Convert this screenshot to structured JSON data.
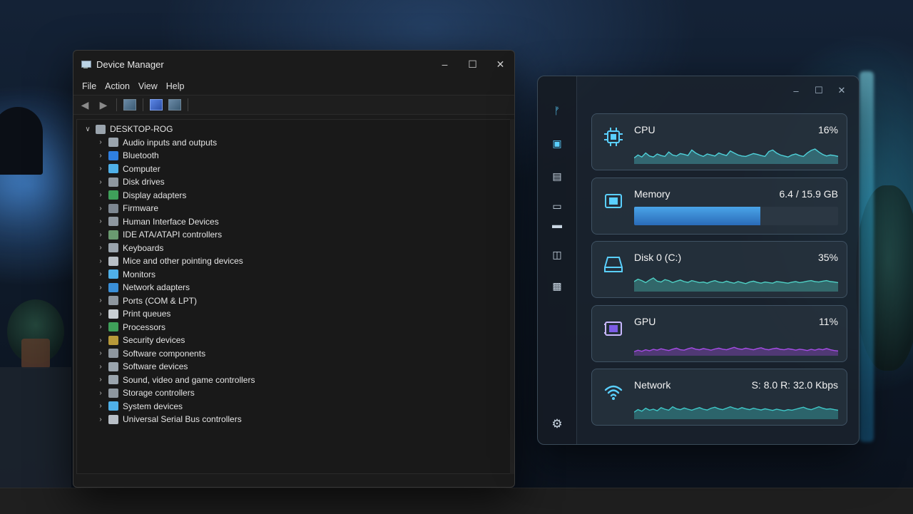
{
  "device_manager": {
    "title": "Device Manager",
    "menu": [
      "File",
      "Action",
      "View",
      "Help"
    ],
    "root": "DESKTOP-ROG",
    "categories": [
      {
        "label": "Audio inputs and outputs",
        "icon": "speaker-icon",
        "color": "#9aa4ad"
      },
      {
        "label": "Bluetooth",
        "icon": "bluetooth-icon",
        "color": "#2f7fe0"
      },
      {
        "label": "Computer",
        "icon": "computer-icon",
        "color": "#4fb0e8"
      },
      {
        "label": "Disk drives",
        "icon": "disk-drive-icon",
        "color": "#8e979f"
      },
      {
        "label": "Display adapters",
        "icon": "display-adapter-icon",
        "color": "#3fa05a"
      },
      {
        "label": "Firmware",
        "icon": "firmware-icon",
        "color": "#7d8791"
      },
      {
        "label": "Human Interface Devices",
        "icon": "hid-icon",
        "color": "#8e979f"
      },
      {
        "label": "IDE ATA/ATAPI controllers",
        "icon": "ide-controller-icon",
        "color": "#6a9a70"
      },
      {
        "label": "Keyboards",
        "icon": "keyboard-icon",
        "color": "#9aa4ad"
      },
      {
        "label": "Mice and other pointing devices",
        "icon": "mouse-icon",
        "color": "#b8bfc6"
      },
      {
        "label": "Monitors",
        "icon": "monitor-icon",
        "color": "#4fb0e8"
      },
      {
        "label": "Network adapters",
        "icon": "network-adapter-icon",
        "color": "#3a8fd8"
      },
      {
        "label": "Ports (COM & LPT)",
        "icon": "port-icon",
        "color": "#8e979f"
      },
      {
        "label": "Print queues",
        "icon": "printer-icon",
        "color": "#c9cfd4"
      },
      {
        "label": "Processors",
        "icon": "processor-icon",
        "color": "#3fa05a"
      },
      {
        "label": "Security devices",
        "icon": "security-device-icon",
        "color": "#b89a3a"
      },
      {
        "label": "Software components",
        "icon": "software-component-icon",
        "color": "#8e979f"
      },
      {
        "label": "Software devices",
        "icon": "software-device-icon",
        "color": "#9aa4ad"
      },
      {
        "label": "Sound, video and game controllers",
        "icon": "sound-icon",
        "color": "#9aa4ad"
      },
      {
        "label": "Storage controllers",
        "icon": "storage-controller-icon",
        "color": "#8e979f"
      },
      {
        "label": "System devices",
        "icon": "system-device-icon",
        "color": "#4fb0e8"
      },
      {
        "label": "Universal Serial Bus controllers",
        "icon": "usb-icon",
        "color": "#b8bfc6"
      }
    ]
  },
  "monitor": {
    "nav_icons": [
      "logo-icon",
      "cpu-nav-icon",
      "memory-nav-icon",
      "disk-nav-icon",
      "gpu-nav-icon",
      "network-nav-icon",
      "app-nav-icon",
      "settings-icon"
    ],
    "cards": [
      {
        "name": "CPU",
        "value": "16%",
        "icon": "cpu-icon",
        "type": "graph",
        "color": "#4fd1d9",
        "samples": [
          0.3,
          0.45,
          0.35,
          0.55,
          0.4,
          0.35,
          0.5,
          0.42,
          0.38,
          0.6,
          0.45,
          0.4,
          0.52,
          0.48,
          0.42,
          0.7,
          0.55,
          0.45,
          0.38,
          0.5,
          0.45,
          0.4,
          0.55,
          0.48,
          0.42,
          0.65,
          0.55,
          0.45,
          0.4,
          0.38,
          0.45,
          0.52,
          0.48,
          0.42,
          0.38,
          0.62,
          0.7,
          0.55,
          0.45,
          0.4,
          0.35,
          0.45,
          0.5,
          0.42,
          0.38,
          0.55,
          0.68,
          0.75,
          0.6,
          0.48,
          0.4,
          0.45,
          0.42,
          0.38
        ]
      },
      {
        "name": "Memory",
        "value": "6.4 / 15.9 GB",
        "icon": "memory-icon",
        "type": "bar",
        "color": "#3b8fdc",
        "usage": 0.62
      },
      {
        "name": "Disk 0 (C:)",
        "value": "35%",
        "icon": "disk-icon",
        "type": "graph",
        "color": "#4fd1c5",
        "samples": [
          0.5,
          0.62,
          0.55,
          0.45,
          0.58,
          0.68,
          0.52,
          0.48,
          0.6,
          0.55,
          0.45,
          0.52,
          0.58,
          0.5,
          0.46,
          0.55,
          0.5,
          0.45,
          0.48,
          0.42,
          0.5,
          0.55,
          0.48,
          0.45,
          0.52,
          0.46,
          0.42,
          0.5,
          0.45,
          0.4,
          0.48,
          0.52,
          0.46,
          0.42,
          0.48,
          0.45,
          0.42,
          0.5,
          0.48,
          0.45,
          0.42,
          0.47,
          0.5,
          0.45,
          0.48,
          0.52,
          0.55,
          0.5,
          0.48,
          0.52,
          0.55,
          0.5,
          0.48,
          0.45
        ]
      },
      {
        "name": "GPU",
        "value": "11%",
        "icon": "gpu-icon",
        "type": "graph",
        "color": "#a64ce6",
        "samples": [
          0.2,
          0.28,
          0.22,
          0.3,
          0.25,
          0.32,
          0.28,
          0.35,
          0.3,
          0.26,
          0.33,
          0.38,
          0.3,
          0.28,
          0.35,
          0.4,
          0.33,
          0.3,
          0.36,
          0.32,
          0.28,
          0.34,
          0.38,
          0.33,
          0.3,
          0.36,
          0.42,
          0.35,
          0.32,
          0.38,
          0.34,
          0.3,
          0.36,
          0.4,
          0.33,
          0.3,
          0.35,
          0.38,
          0.32,
          0.3,
          0.35,
          0.32,
          0.28,
          0.33,
          0.3,
          0.26,
          0.32,
          0.28,
          0.34,
          0.3,
          0.36,
          0.3,
          0.26,
          0.24
        ]
      },
      {
        "name": "Network",
        "value": "S: 8.0  R: 32.0 Kbps",
        "icon": "wifi-icon",
        "type": "graph",
        "color": "#3fc8c8",
        "samples": [
          0.35,
          0.48,
          0.4,
          0.55,
          0.45,
          0.5,
          0.42,
          0.58,
          0.5,
          0.45,
          0.62,
          0.52,
          0.48,
          0.56,
          0.5,
          0.45,
          0.52,
          0.58,
          0.5,
          0.46,
          0.55,
          0.6,
          0.52,
          0.48,
          0.55,
          0.62,
          0.55,
          0.5,
          0.58,
          0.52,
          0.48,
          0.55,
          0.5,
          0.46,
          0.52,
          0.48,
          0.44,
          0.5,
          0.46,
          0.42,
          0.48,
          0.45,
          0.5,
          0.55,
          0.6,
          0.52,
          0.48,
          0.55,
          0.62,
          0.55,
          0.5,
          0.52,
          0.48,
          0.45
        ]
      }
    ]
  }
}
